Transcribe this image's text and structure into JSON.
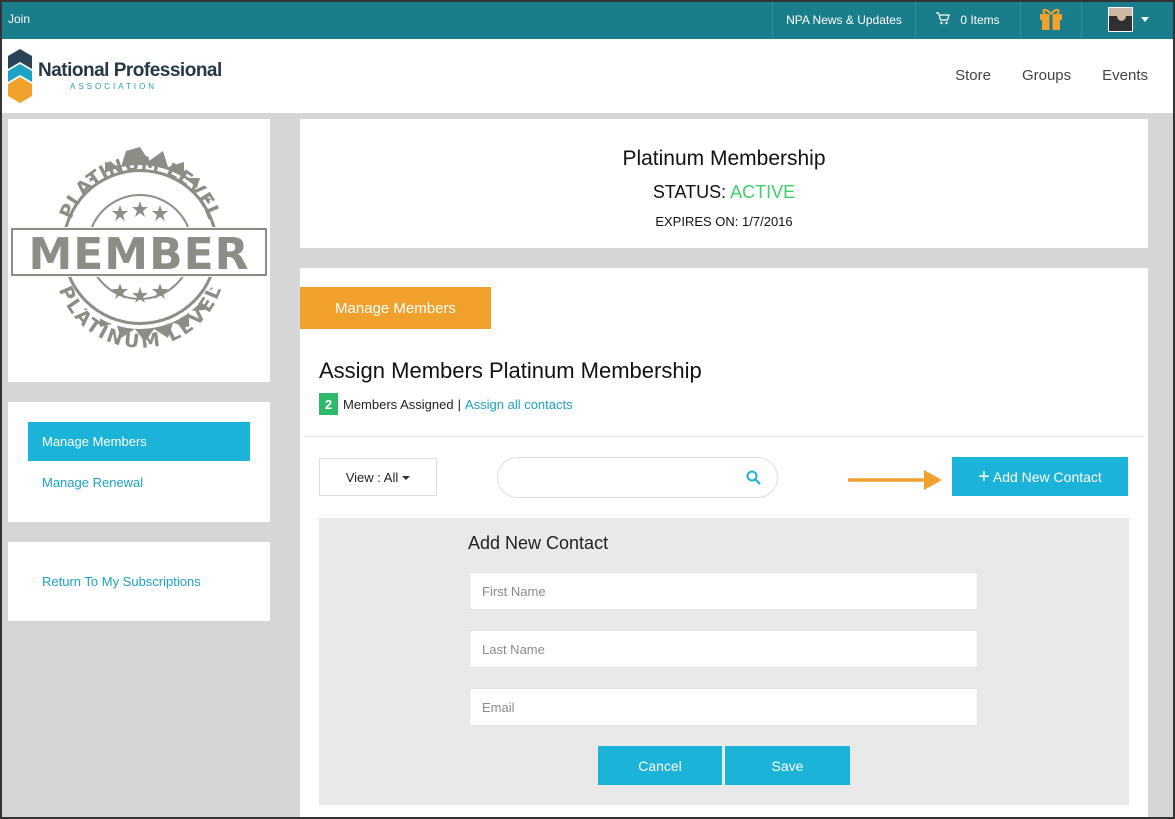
{
  "topbar": {
    "join_label": "Join",
    "news_label": "NPA News & Updates",
    "cart_label": "0 Items",
    "cart_icon": "cart-icon",
    "gift_icon": "gift-icon",
    "user_icon": "avatar"
  },
  "header": {
    "logo_title": "National Professional",
    "logo_subtitle": "ASSOCIATION",
    "nav": [
      {
        "label": "Store"
      },
      {
        "label": "Groups"
      },
      {
        "label": "Events"
      }
    ]
  },
  "badge": {
    "top_text": "PLATINUM LEVEL",
    "main_text": "MEMBER",
    "bottom_text": "PLATINUM LEVEL"
  },
  "sidebar": {
    "items": [
      {
        "label": "Manage Members",
        "active": true
      },
      {
        "label": "Manage Renewal",
        "active": false
      }
    ],
    "return_label": "Return To My Subscriptions"
  },
  "status": {
    "plan_name": "Platinum Membership",
    "status_label": "STATUS:",
    "status_value": "ACTIVE",
    "expires": "EXPIRES ON: 1/7/2016"
  },
  "manage": {
    "tab_label": "Manage Members",
    "title": "Assign Members Platinum Membership",
    "assigned_count": "2",
    "assigned_text": "Members Assigned",
    "separator": "|",
    "assign_all_label": "Assign all contacts",
    "view_label": "View : All",
    "search_placeholder": "",
    "add_contact_label": "Add New Contact"
  },
  "form": {
    "title": "Add New Contact",
    "first_name_placeholder": "First Name",
    "last_name_placeholder": "Last Name",
    "email_placeholder": "Email",
    "cancel_label": "Cancel",
    "save_label": "Save"
  },
  "colors": {
    "topbar": "#1a7d8c",
    "accent_blue": "#1cb3d9",
    "accent_orange": "#f0a12c",
    "active_green": "#3ecf6a",
    "badge_green": "#2dbb6a"
  }
}
